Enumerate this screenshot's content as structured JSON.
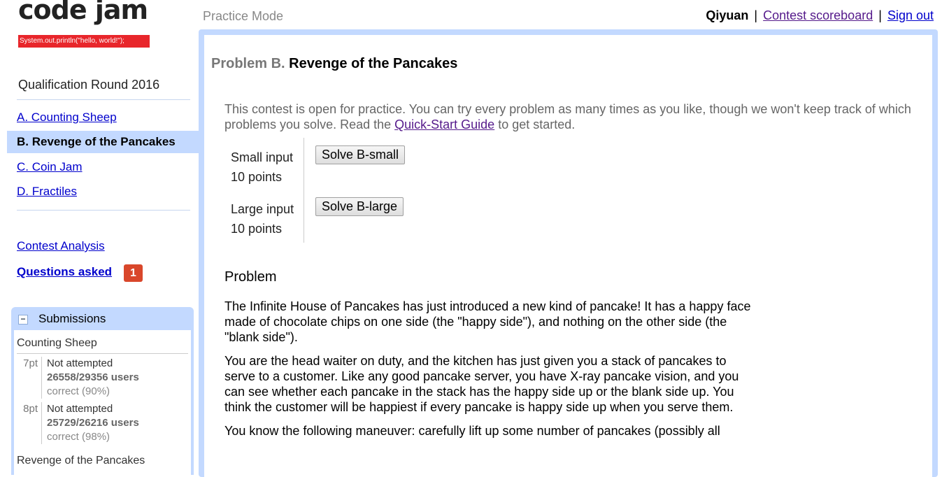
{
  "logo": {
    "title": "code jam",
    "tagline": "System.out.println(\"hello, world!\");"
  },
  "header": {
    "mode": "Practice Mode",
    "username": "Qiyuan",
    "separator": "|",
    "scoreboard_link": "Contest scoreboard",
    "signout_link": "Sign out"
  },
  "sidebar": {
    "round_title": "Qualification Round 2016",
    "problems": [
      {
        "label": "A. Counting Sheep"
      },
      {
        "label": "B. Revenge of the Pancakes"
      },
      {
        "label": "C. Coin Jam"
      },
      {
        "label": "D. Fractiles"
      }
    ],
    "contest_analysis": "Contest Analysis",
    "questions_asked": "Questions asked",
    "questions_count": "1"
  },
  "submissions": {
    "title": "Submissions",
    "toggle": "−",
    "problem_name": "Counting Sheep",
    "rows": [
      {
        "points": "7pt",
        "status": "Not attempted",
        "users": "26558/29356 users",
        "correct": "correct (90%)"
      },
      {
        "points": "8pt",
        "status": "Not attempted",
        "users": "25729/26216 users",
        "correct": "correct (98%)"
      }
    ],
    "next_problem": "Revenge of the Pancakes"
  },
  "main": {
    "problem_label": "Problem B.",
    "problem_name": "Revenge of the Pancakes",
    "practice_note_before": "This contest is open for practice. You can try every problem as many times as you like, though we won't keep track of which problems you solve. Read the ",
    "quick_start_link": "Quick-Start Guide",
    "practice_note_after": " to get started.",
    "small_input_label": "Small input",
    "small_input_points": "10 points",
    "small_button": "Solve B-small",
    "large_input_label": "Large input",
    "large_input_points": "10 points",
    "large_button": "Solve B-large",
    "problem_heading": "Problem",
    "paragraphs": [
      "The Infinite House of Pancakes has just introduced a new kind of pancake! It has a happy face made of chocolate chips on one side (the \"happy side\"), and nothing on the other side (the \"blank side\").",
      "You are the head waiter on duty, and the kitchen has just given you a stack of pancakes to serve to a customer. Like any good pancake server, you have X-ray pancake vision, and you can see whether each pancake in the stack has the happy side up or the blank side up. You think the customer will be happiest if every pancake is happy side up when you serve them.",
      "You know the following maneuver: carefully lift up some number of pancakes (possibly all"
    ]
  }
}
